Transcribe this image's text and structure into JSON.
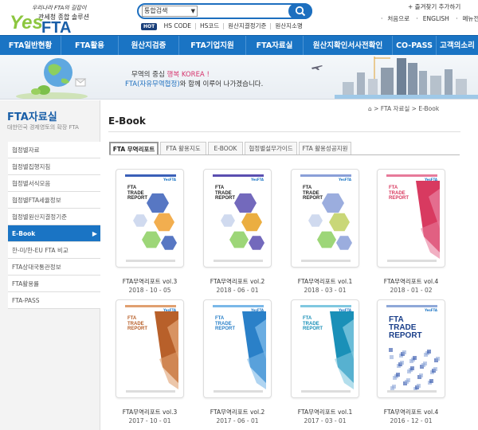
{
  "header": {
    "logo_tagline": "우리나라 FTA의 길잡이",
    "logo_sub": "관세청 종합 솔루션",
    "logo_yes": "Yes",
    "logo_fta": "FTA",
    "search": {
      "select_value": "통합검색",
      "placeholder": ""
    },
    "hot_badge": "HOT",
    "hot_keywords": [
      "HS CODE",
      "HS코드",
      "원산지결정기준",
      "원산지소명"
    ],
    "util": {
      "favorite": "+ 즐겨찾기 추가하기",
      "links": [
        "처음으로",
        "ENGLISH",
        "메뉴전체보기"
      ]
    }
  },
  "nav": {
    "items": [
      "FTA일반현황",
      "FTA활용",
      "원산지검증",
      "FTA기업지원",
      "FTA자료실",
      "원산지확인서사전확인",
      "CO-PASS",
      "고객의소리"
    ]
  },
  "banner": {
    "line1_a": "무역의 중심 ",
    "line1_b": "행복 KOREA !",
    "line2_a": "FTA(자유무역협정)",
    "line2_b": "와 함께 이루어 나가겠습니다."
  },
  "sidebar": {
    "title": "FTA자료실",
    "subtitle": "대한민국 경제영토의 확장 FTA",
    "items": [
      {
        "label": "협정별자료",
        "active": false
      },
      {
        "label": "협정별집행지침",
        "active": false
      },
      {
        "label": "협정별서식모음",
        "active": false
      },
      {
        "label": "협정별FTA세율정보",
        "active": false
      },
      {
        "label": "협정별원산지결정기준",
        "active": false
      },
      {
        "label": "E-Book",
        "active": true
      },
      {
        "label": "한-미/한-EU FTA 비교",
        "active": false
      },
      {
        "label": "FTA상대국통관정보",
        "active": false
      },
      {
        "label": "FTA활용률",
        "active": false
      },
      {
        "label": "FTA-PASS",
        "active": false
      }
    ]
  },
  "breadcrumb": {
    "items": [
      "FTA 자료실",
      "E-Book"
    ]
  },
  "page_title": "E-Book",
  "tabs": [
    "FTA 무역리포트",
    "FTA 활용지도",
    "E-BOOK",
    "협정별설무가이드",
    "FTA 활용성공지원"
  ],
  "books": [
    {
      "title": "FTA무역리포트 vol.3",
      "date": "2018 - 10 - 05",
      "cover_title": "FTA\nTRADE\nREPORT",
      "accent": "#f0a030",
      "accent2": "#3a5fb8",
      "style": "hex"
    },
    {
      "title": "FTA무역리포트 vol.2",
      "date": "2018 - 06 - 01",
      "cover_title": "FTA\nTRADE\nREPORT",
      "accent": "#e8a020",
      "accent2": "#5a4fb0",
      "style": "hex"
    },
    {
      "title": "FTA무역리포트 vol.1",
      "date": "2018 - 03 - 01",
      "cover_title": "FTA\nTRADE\nREPORT",
      "accent": "#c0d060",
      "accent2": "#8a9fd8",
      "style": "hex"
    },
    {
      "title": "FTA무역리포트 vol.4",
      "date": "2018 - 01 - 02",
      "cover_title": "FTA\nTRADE\nREPORT",
      "accent": "#d83a60",
      "accent2": "#e77a9a",
      "style": "diag"
    },
    {
      "title": "FTA무역리포트 vol.3",
      "date": "2017 - 10 - 01",
      "cover_title": "FTA\nTRADE\nREPORT",
      "accent": "#b8602a",
      "accent2": "#e0a070",
      "style": "diag"
    },
    {
      "title": "FTA무역리포트 vol.2",
      "date": "2017 - 06 - 01",
      "cover_title": "FTA\nTRADE\nREPORT",
      "accent": "#2a80c8",
      "accent2": "#7ab8e8",
      "style": "diag"
    },
    {
      "title": "FTA무역리포트 vol.1",
      "date": "2017 - 03 - 01",
      "cover_title": "FTA\nTRADE\nREPORT",
      "accent": "#1a90b8",
      "accent2": "#80c8e0",
      "style": "diag"
    },
    {
      "title": "FTA무역리포트 vol.4",
      "date": "2016 - 12 - 01",
      "cover_title": "FTA\nTRADE\nREPORT",
      "accent": "#2a4fa8",
      "accent2": "#8fa8d8",
      "style": "pixel"
    }
  ]
}
